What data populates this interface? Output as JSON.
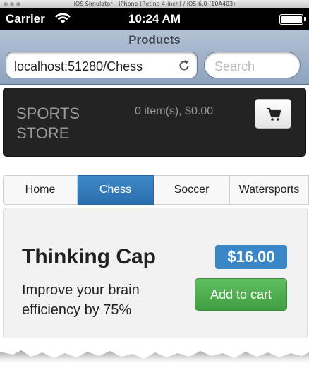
{
  "simulator": {
    "title": "iOS Simulator – iPhone (Retina 4-inch) / iOS 6.0 (10A403)"
  },
  "status_bar": {
    "carrier": "Carrier",
    "time": "10:24 AM"
  },
  "browser": {
    "page_title": "Products",
    "url": "localhost:51280/Chess",
    "search_placeholder": "Search"
  },
  "store": {
    "brand": "SPORTS STORE",
    "cart_summary": "0 item(s), $0.00"
  },
  "categories": [
    {
      "label": "Home",
      "active": false
    },
    {
      "label": "Chess",
      "active": true
    },
    {
      "label": "Soccer",
      "active": false
    },
    {
      "label": "Watersports",
      "active": false
    }
  ],
  "product": {
    "name": "Thinking Cap",
    "price": "$16.00",
    "description": "Improve your brain efficiency by 75%",
    "add_label": "Add to cart"
  },
  "colors": {
    "nav_background": "#232323",
    "active_tab": "#2f7bbd",
    "price_badge": "#3a87c8",
    "add_button": "#4cae4c"
  },
  "icons": [
    "wifi-icon",
    "battery-icon",
    "reload-icon",
    "cart-icon"
  ]
}
